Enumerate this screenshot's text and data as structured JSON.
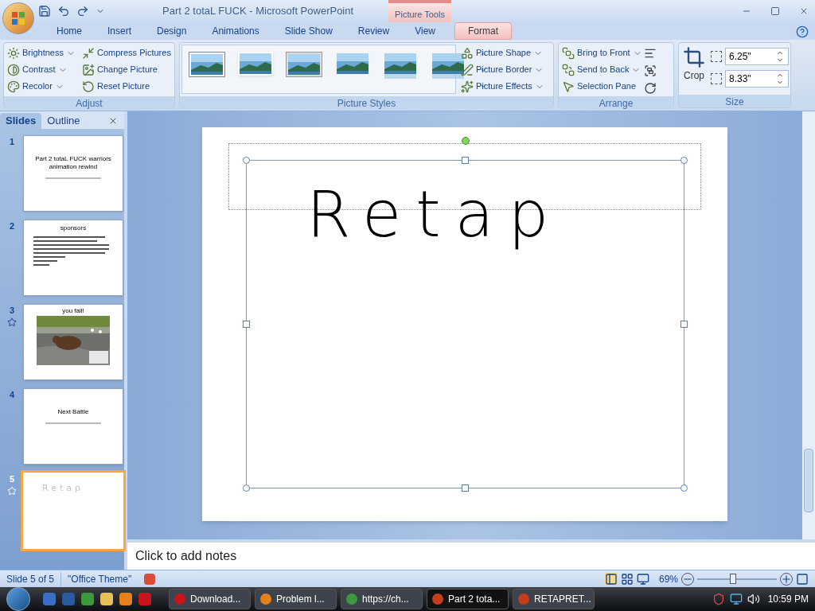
{
  "window": {
    "title": "Part 2 totaL FUCK - Microsoft PowerPoint",
    "context_group": "Picture Tools"
  },
  "ribbon_tabs": [
    {
      "label": "Home",
      "selected": false
    },
    {
      "label": "Insert",
      "selected": false
    },
    {
      "label": "Design",
      "selected": false
    },
    {
      "label": "Animations",
      "selected": false
    },
    {
      "label": "Slide Show",
      "selected": false
    },
    {
      "label": "Review",
      "selected": false
    },
    {
      "label": "View",
      "selected": false
    },
    {
      "label": "Format",
      "selected": true
    }
  ],
  "adjust": {
    "label": "Adjust",
    "left": [
      {
        "kind": "brightness",
        "label": "Brightness",
        "dropdown": true
      },
      {
        "kind": "contrast",
        "label": "Contrast",
        "dropdown": true
      },
      {
        "kind": "recolor",
        "label": "Recolor",
        "dropdown": true
      }
    ],
    "right": [
      {
        "kind": "compress",
        "label": "Compress Pictures",
        "dropdown": false
      },
      {
        "kind": "change",
        "label": "Change Picture",
        "dropdown": false
      },
      {
        "kind": "reset",
        "label": "Reset Picture",
        "dropdown": false
      }
    ]
  },
  "picture_styles": {
    "label": "Picture Styles",
    "gallery": [
      {
        "kind": "frame"
      },
      {
        "kind": "white"
      },
      {
        "kind": "grey"
      },
      {
        "kind": "soft"
      },
      {
        "kind": "reflect"
      },
      {
        "kind": "reflect"
      }
    ],
    "commands": [
      {
        "kind": "shape",
        "label": "Picture Shape",
        "dropdown": true
      },
      {
        "kind": "border",
        "label": "Picture Border",
        "dropdown": true
      },
      {
        "kind": "effects",
        "label": "Picture Effects",
        "dropdown": true
      }
    ]
  },
  "arrange": {
    "label": "Arrange",
    "commands": [
      {
        "kind": "front",
        "label": "Bring to Front",
        "dropdown": true
      },
      {
        "kind": "back",
        "label": "Send to Back",
        "dropdown": true
      },
      {
        "kind": "pane",
        "label": "Selection Pane",
        "dropdown": false
      }
    ]
  },
  "size": {
    "label": "Size",
    "crop": "Crop",
    "height": "6.25\"",
    "width": "8.33\""
  },
  "pane_tabs": [
    {
      "label": "Slides",
      "selected": true
    },
    {
      "label": "Outline",
      "selected": false
    }
  ],
  "slides": [
    {
      "number": "1",
      "kind": "title",
      "title": "Part 2 totaL FUCK  warriors animation rewind",
      "animated": false,
      "selected": false
    },
    {
      "number": "2",
      "kind": "bullets",
      "title": "sponsors",
      "animated": false,
      "selected": false
    },
    {
      "number": "3",
      "kind": "picture",
      "title": "you fail!",
      "animated": true,
      "selected": false
    },
    {
      "number": "4",
      "kind": "title",
      "title": "Next Battle",
      "animated": false,
      "selected": false
    },
    {
      "number": "5",
      "kind": "ink",
      "title": "Retap",
      "animated": true,
      "selected": true
    }
  ],
  "slide": {
    "ink": "Retap"
  },
  "notes": {
    "placeholder": "Click to add notes"
  },
  "status_bar": {
    "slide": "Slide 5 of 5",
    "theme": "\"Office Theme\"",
    "zoom": "69%",
    "zoom_level": {
      "level": 0.45
    }
  },
  "taskbar": {
    "buttons": [
      {
        "kind": "opera",
        "label": "Download...",
        "selected": false
      },
      {
        "kind": "firefox",
        "label": "Problem l...",
        "selected": false
      },
      {
        "kind": "chrome",
        "label": "https://ch...",
        "selected": false
      },
      {
        "kind": "ppt",
        "label": "Part 2 tota...",
        "selected": true
      },
      {
        "kind": "ppt",
        "label": "RETAPRET...",
        "selected": false
      }
    ],
    "clock": "10:59 PM"
  }
}
